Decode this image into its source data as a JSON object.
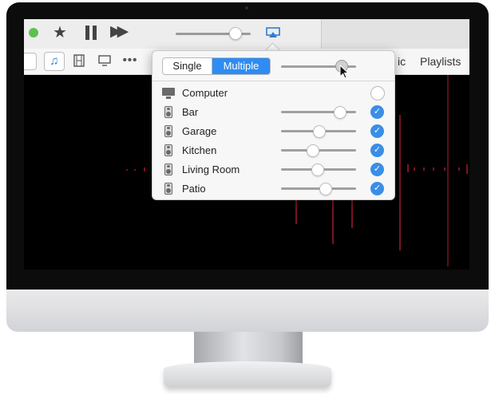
{
  "toolbar": {
    "icons": [
      "play-status-dot",
      "star-icon",
      "pause-icon",
      "fast-forward-icon",
      "airplay-icon",
      "close-icon"
    ],
    "volume_level": 0.8
  },
  "nav": {
    "music_text": "ic",
    "playlists": "Playlists"
  },
  "airplay_popover": {
    "segment": {
      "single": "Single",
      "multiple": "Multiple",
      "selected": "Multiple"
    },
    "master_volume": 0.8,
    "devices": [
      {
        "name": "Computer",
        "icon": "computer-icon",
        "checked": false,
        "volume": null
      },
      {
        "name": "Bar",
        "icon": "speaker-icon",
        "checked": true,
        "volume": 0.78
      },
      {
        "name": "Garage",
        "icon": "speaker-icon",
        "checked": true,
        "volume": 0.5
      },
      {
        "name": "Kitchen",
        "icon": "speaker-icon",
        "checked": true,
        "volume": 0.42
      },
      {
        "name": "Living Room",
        "icon": "speaker-icon",
        "checked": true,
        "volume": 0.48
      },
      {
        "name": "Patio",
        "icon": "speaker-icon",
        "checked": true,
        "volume": 0.58
      }
    ]
  },
  "colors": {
    "accent": "#2f8cf2",
    "check": "#3a8ee6",
    "visualizer": "#7a1424",
    "status_dot": "#5fc050"
  }
}
